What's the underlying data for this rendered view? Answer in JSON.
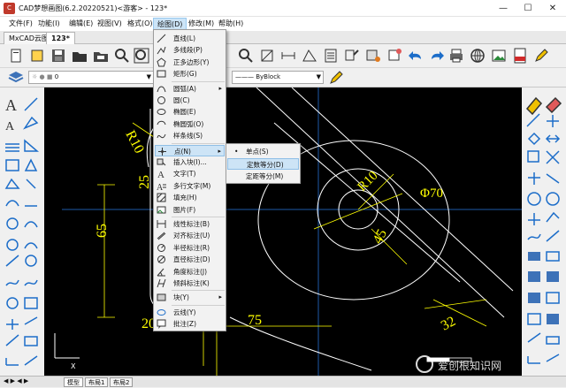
{
  "window": {
    "title": "CAD梦想画图(6.2.20220521)<游客> - 123*",
    "controls": {
      "minimize": "—",
      "maximize": "☐",
      "close": "✕"
    }
  },
  "menubar": {
    "items": [
      "文件(F)",
      "功能(I)",
      "编辑(E)",
      "视图(V)",
      "格式(O)",
      "绘图(D)",
      "修改(M)",
      "帮助(H)"
    ]
  },
  "tabs": {
    "items": [
      "MxCAD云图",
      "123*"
    ]
  },
  "toolbar": {
    "layer_value": "0",
    "linetype_value": "ByBlock",
    "icons": [
      "layer-icon",
      "new-file-icon",
      "open-folder-icon",
      "save-icon",
      "print-icon",
      "undo-icon",
      "redo-icon",
      "zoom-icon",
      "pan-icon",
      "globe-icon",
      "pdf-icon",
      "pencil-icon"
    ]
  },
  "draw_menu": {
    "items": [
      {
        "label": "直线(L)",
        "icon": "line-icon"
      },
      {
        "label": "多线段(P)",
        "icon": "polyline-icon"
      },
      {
        "label": "正多边形(Y)",
        "icon": "polygon-icon"
      },
      {
        "label": "矩形(G)",
        "icon": "rectangle-icon"
      },
      {
        "label": "圆弧(A)",
        "icon": "arc-icon",
        "submenu": true
      },
      {
        "label": "圆(C)",
        "icon": "circle-icon"
      },
      {
        "label": "椭圆(E)",
        "icon": "ellipse-icon"
      },
      {
        "label": "椭圆弧(O)",
        "icon": "ellipse-arc-icon"
      },
      {
        "label": "样条线(S)",
        "icon": "spline-icon"
      },
      {
        "label": "点(N)",
        "icon": "point-icon",
        "submenu": true
      },
      {
        "label": "插入块(I)...",
        "icon": "insert-block-icon"
      },
      {
        "label": "文字(T)",
        "icon": "text-icon"
      },
      {
        "label": "多行文字(M)",
        "icon": "mtext-icon"
      },
      {
        "label": "填充(H)",
        "icon": "hatch-icon"
      },
      {
        "label": "图片(F)",
        "icon": "image-icon"
      },
      {
        "label": "线性标注(B)",
        "icon": "dim-linear-icon"
      },
      {
        "label": "对齐标注(U)",
        "icon": "dim-aligned-icon"
      },
      {
        "label": "半径标注(R)",
        "icon": "dim-radius-icon"
      },
      {
        "label": "直径标注(D)",
        "icon": "dim-diameter-icon"
      },
      {
        "label": "角度标注(J)",
        "icon": "dim-angle-icon"
      },
      {
        "label": "倾斜标注(K)",
        "icon": "dim-oblique-icon"
      },
      {
        "label": "块(Y)",
        "icon": "block-icon",
        "submenu": true
      },
      {
        "label": "云线(Y)",
        "icon": "revcloud-icon"
      },
      {
        "label": "批注(Z)",
        "icon": "comment-icon"
      }
    ],
    "arrow": "▸"
  },
  "point_submenu": {
    "items": [
      "单点(S)",
      "定数等分(D)",
      "定距等分(M)"
    ],
    "bullet": "•"
  },
  "drawing": {
    "dims": [
      "R10",
      "Φ70",
      "45",
      "25",
      "65",
      "75",
      "32",
      "R10",
      "20"
    ],
    "colors": {
      "dim": "#ffff00",
      "geometry": "#ffffff",
      "center": "#1e5aa8",
      "background": "#000000"
    }
  },
  "layouts": {
    "items": [
      "模型",
      "布局1",
      "布局2"
    ]
  },
  "watermark": {
    "text": "爱创根知识网"
  },
  "colors": {
    "menu_highlight": "#cce4f7",
    "layer_yellow": "#f0c000"
  }
}
